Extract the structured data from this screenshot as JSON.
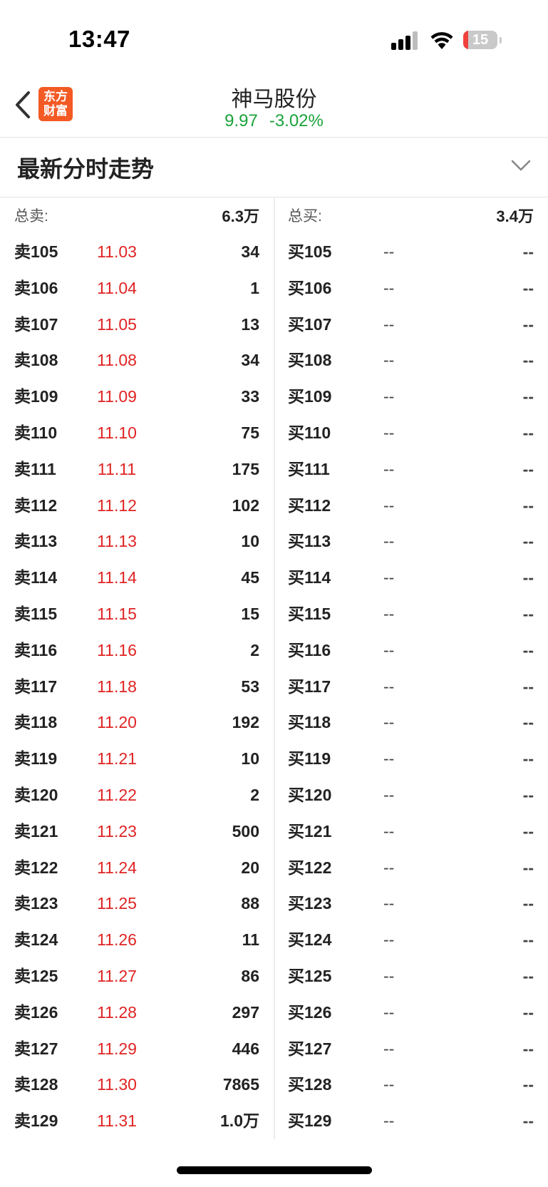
{
  "status_bar": {
    "time": "13:47",
    "battery": "15",
    "battery_color": "#f0413d",
    "icons": [
      "signal-icon",
      "wifi-icon",
      "battery-icon"
    ]
  },
  "header": {
    "back_icon": "chevron-left-icon",
    "logo_line1": "东方",
    "logo_line2": "财富",
    "logo_color": "#f35a24",
    "stock_name": "神马股份",
    "price": "9.97",
    "change": "-3.02%",
    "quote_color": "#1aa33a"
  },
  "section": {
    "title": "最新分时走势",
    "toggle_icon": "chevron-down-icon"
  },
  "order_book": {
    "sell_total_label": "总卖:",
    "sell_total_value": "6.3万",
    "buy_total_label": "总买:",
    "buy_total_value": "3.4万",
    "price_color": "#e02424",
    "sell": [
      {
        "label": "卖105",
        "price": "11.03",
        "volume": "34"
      },
      {
        "label": "卖106",
        "price": "11.04",
        "volume": "1"
      },
      {
        "label": "卖107",
        "price": "11.05",
        "volume": "13"
      },
      {
        "label": "卖108",
        "price": "11.08",
        "volume": "34"
      },
      {
        "label": "卖109",
        "price": "11.09",
        "volume": "33"
      },
      {
        "label": "卖110",
        "price": "11.10",
        "volume": "75"
      },
      {
        "label": "卖111",
        "price": "11.11",
        "volume": "175"
      },
      {
        "label": "卖112",
        "price": "11.12",
        "volume": "102"
      },
      {
        "label": "卖113",
        "price": "11.13",
        "volume": "10"
      },
      {
        "label": "卖114",
        "price": "11.14",
        "volume": "45"
      },
      {
        "label": "卖115",
        "price": "11.15",
        "volume": "15"
      },
      {
        "label": "卖116",
        "price": "11.16",
        "volume": "2"
      },
      {
        "label": "卖117",
        "price": "11.18",
        "volume": "53"
      },
      {
        "label": "卖118",
        "price": "11.20",
        "volume": "192"
      },
      {
        "label": "卖119",
        "price": "11.21",
        "volume": "10"
      },
      {
        "label": "卖120",
        "price": "11.22",
        "volume": "2"
      },
      {
        "label": "卖121",
        "price": "11.23",
        "volume": "500"
      },
      {
        "label": "卖122",
        "price": "11.24",
        "volume": "20"
      },
      {
        "label": "卖123",
        "price": "11.25",
        "volume": "88"
      },
      {
        "label": "卖124",
        "price": "11.26",
        "volume": "11"
      },
      {
        "label": "卖125",
        "price": "11.27",
        "volume": "86"
      },
      {
        "label": "卖126",
        "price": "11.28",
        "volume": "297"
      },
      {
        "label": "卖127",
        "price": "11.29",
        "volume": "446"
      },
      {
        "label": "卖128",
        "price": "11.30",
        "volume": "7865"
      },
      {
        "label": "卖129",
        "price": "11.31",
        "volume": "1.0万"
      }
    ],
    "buy": [
      {
        "label": "买105",
        "price": "--",
        "volume": "--"
      },
      {
        "label": "买106",
        "price": "--",
        "volume": "--"
      },
      {
        "label": "买107",
        "price": "--",
        "volume": "--"
      },
      {
        "label": "买108",
        "price": "--",
        "volume": "--"
      },
      {
        "label": "买109",
        "price": "--",
        "volume": "--"
      },
      {
        "label": "买110",
        "price": "--",
        "volume": "--"
      },
      {
        "label": "买111",
        "price": "--",
        "volume": "--"
      },
      {
        "label": "买112",
        "price": "--",
        "volume": "--"
      },
      {
        "label": "买113",
        "price": "--",
        "volume": "--"
      },
      {
        "label": "买114",
        "price": "--",
        "volume": "--"
      },
      {
        "label": "买115",
        "price": "--",
        "volume": "--"
      },
      {
        "label": "买116",
        "price": "--",
        "volume": "--"
      },
      {
        "label": "买117",
        "price": "--",
        "volume": "--"
      },
      {
        "label": "买118",
        "price": "--",
        "volume": "--"
      },
      {
        "label": "买119",
        "price": "--",
        "volume": "--"
      },
      {
        "label": "买120",
        "price": "--",
        "volume": "--"
      },
      {
        "label": "买121",
        "price": "--",
        "volume": "--"
      },
      {
        "label": "买122",
        "price": "--",
        "volume": "--"
      },
      {
        "label": "买123",
        "price": "--",
        "volume": "--"
      },
      {
        "label": "买124",
        "price": "--",
        "volume": "--"
      },
      {
        "label": "买125",
        "price": "--",
        "volume": "--"
      },
      {
        "label": "买126",
        "price": "--",
        "volume": "--"
      },
      {
        "label": "买127",
        "price": "--",
        "volume": "--"
      },
      {
        "label": "买128",
        "price": "--",
        "volume": "--"
      },
      {
        "label": "买129",
        "price": "--",
        "volume": "--"
      }
    ]
  }
}
